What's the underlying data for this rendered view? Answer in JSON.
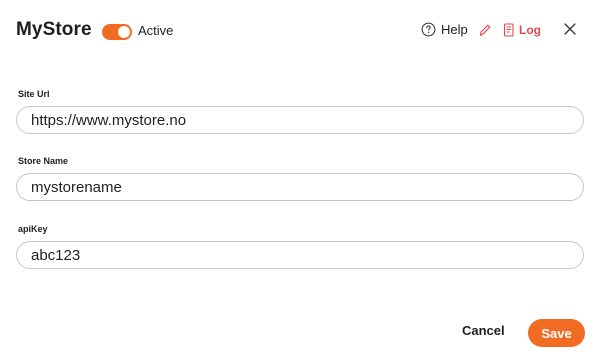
{
  "header": {
    "title": "MyStore",
    "active_label": "Active",
    "active_on": true,
    "help_label": "Help",
    "log_label": "Log",
    "icons": {
      "help": "help-circle-icon",
      "edit": "pencil-icon",
      "log": "document-icon",
      "close": "close-icon"
    }
  },
  "form": {
    "site_url": {
      "label": "Site Url",
      "value": "https://www.mystore.no"
    },
    "store_name": {
      "label": "Store Name",
      "value": "mystorename"
    },
    "api_key": {
      "label": "apiKey",
      "value": "abc123"
    }
  },
  "footer": {
    "cancel_label": "Cancel",
    "save_label": "Save"
  },
  "colors": {
    "accent": "#f26b22",
    "log_red": "#e5484d",
    "border": "#c8c8c8"
  }
}
